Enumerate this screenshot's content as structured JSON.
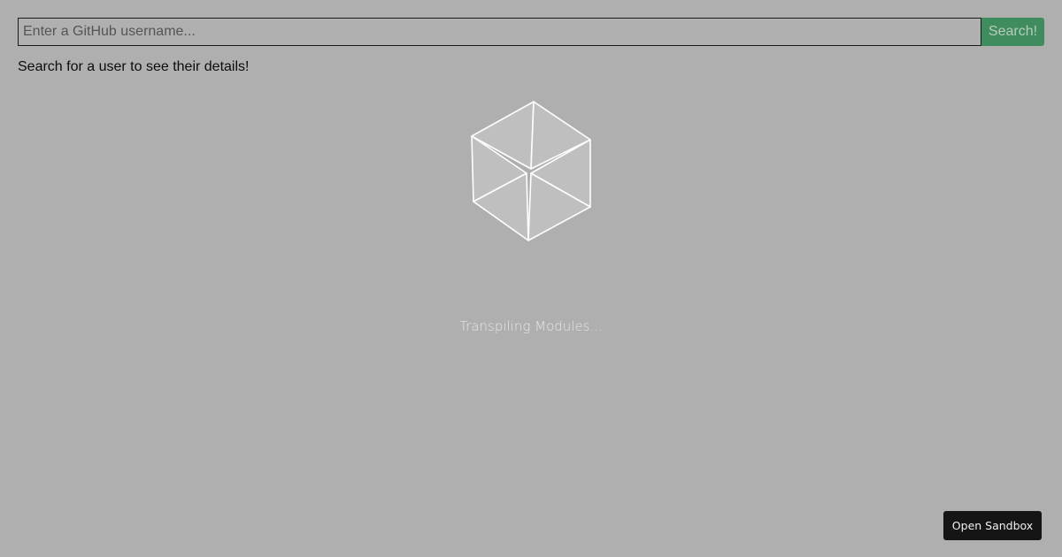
{
  "search": {
    "placeholder": "Enter a GitHub username...",
    "value": "",
    "button_label": "Search!"
  },
  "hint_text": "Search for a user to see their details!",
  "loader": {
    "icon": "cube-icon",
    "status_text": "Transpiling Modules..."
  },
  "footer": {
    "open_sandbox_label": "Open Sandbox"
  },
  "colors": {
    "page_background": "#afafaf",
    "search_button": "#3f8d5f",
    "open_sandbox_button": "#151515"
  }
}
